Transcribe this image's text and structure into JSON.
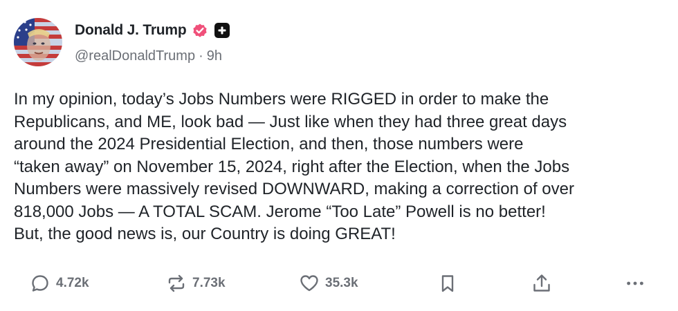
{
  "author": {
    "display_name": "Donald J. Trump",
    "handle": "@realDonaldTrump",
    "separator": "·",
    "timestamp": "9h",
    "verified_icon": "verified-badge-icon",
    "plus_icon": "plus-badge-icon"
  },
  "post": {
    "lines": [
      "In my opinion, today’s Jobs Numbers were RIGGED in order to make the",
      "Republicans, and ME, look bad — Just like when they had three great days",
      "around the 2024 Presidential Election, and then, those numbers were",
      "“taken away” on November 15, 2024, right after the Election, when the Jobs",
      "Numbers were massively revised DOWNWARD, making a correction of over",
      "818,000 Jobs — A TOTAL SCAM. Jerome “Too Late” Powell is no better!",
      "But, the good news is, our Country is doing GREAT!"
    ]
  },
  "actions": {
    "replies": "4.72k",
    "reposts": "7.73k",
    "likes": "35.3k",
    "icons": [
      "reply-icon",
      "repost-icon",
      "like-icon",
      "bookmark-icon",
      "share-icon",
      "more-icon"
    ]
  },
  "colors": {
    "text": "#1f2328",
    "muted": "#6b6f76",
    "verified": "#f0507a",
    "plus_badge": "#111111"
  }
}
